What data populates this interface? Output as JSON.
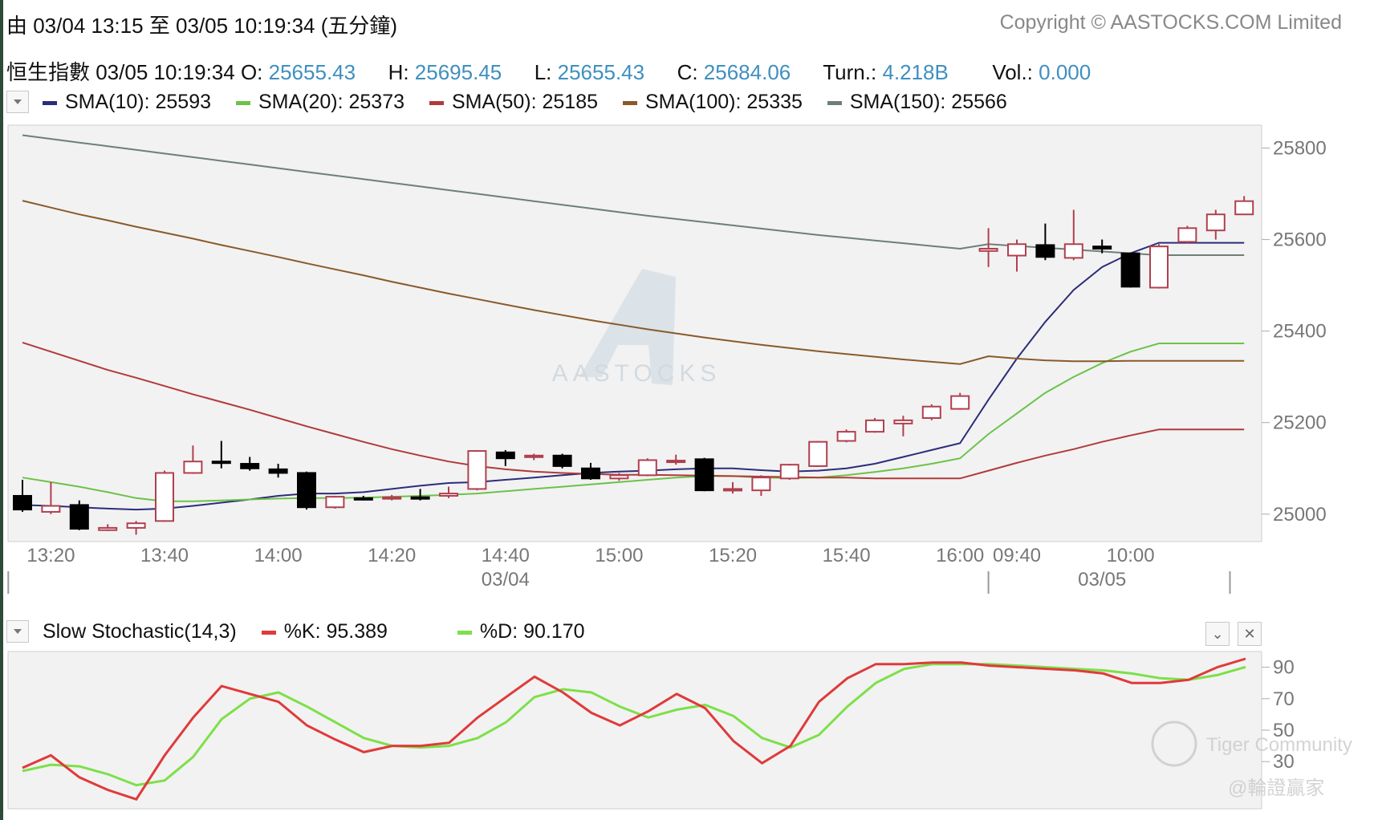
{
  "header": {
    "range_text": "由  03/04 13:15 至  03/05 10:19:34 (五分鐘)",
    "copyright": "Copyright © AASTOCKS.COM Limited"
  },
  "quote": {
    "name_time": "恒生指數  03/05 10:19:34",
    "o_label": "O:",
    "o_value": "25655.43",
    "h_label": "H:",
    "h_value": "25695.45",
    "l_label": "L:",
    "l_value": "25655.43",
    "c_label": "C:",
    "c_value": "25684.06",
    "turn_label": "Turn.:",
    "turn_value": "4.218B",
    "vol_label": "Vol.:",
    "vol_value": "0.000"
  },
  "sma_legend": [
    {
      "label": "SMA(10): 25593",
      "color": "#2b2d7a"
    },
    {
      "label": "SMA(20): 25373",
      "color": "#6cc24a"
    },
    {
      "label": "SMA(50): 25185",
      "color": "#b23a3a"
    },
    {
      "label": "SMA(100): 25335",
      "color": "#8a5a2a"
    },
    {
      "label": "SMA(150): 25566",
      "color": "#6e7f7a"
    }
  ],
  "stoch_legend": {
    "title": "Slow Stochastic(14,3)",
    "k_label": "%K: 95.389",
    "k_color": "#e03a3a",
    "d_label": "%D: 90.170",
    "d_color": "#7de04a"
  },
  "watermarks": {
    "aastocks": "AASTOCKS",
    "tiger": "Tiger Community",
    "tiger_sub": "@輪證贏家"
  },
  "chart_data": {
    "type": "candlestick",
    "price_axis": {
      "ticks": [
        25000,
        25200,
        25400,
        25600,
        25800
      ],
      "range": [
        24940,
        25850
      ]
    },
    "time_axis": {
      "tick_labels": [
        {
          "label": "13:20",
          "index": 1
        },
        {
          "label": "13:40",
          "index": 5
        },
        {
          "label": "14:00",
          "index": 9
        },
        {
          "label": "14:20",
          "index": 13
        },
        {
          "label": "14:40",
          "index": 17
        },
        {
          "label": "15:00",
          "index": 21
        },
        {
          "label": "15:20",
          "index": 25
        },
        {
          "label": "15:40",
          "index": 29
        },
        {
          "label": "16:00",
          "index": 33
        },
        {
          "label": "09:40",
          "index": 35
        },
        {
          "label": "10:00",
          "index": 39
        }
      ],
      "date_labels": [
        {
          "label": "03/04",
          "index": 17
        },
        {
          "label": "03/05",
          "index": 38
        }
      ],
      "day_separators": [
        -0.5,
        34,
        42.5
      ]
    },
    "candles": [
      {
        "o": 25040,
        "h": 25075,
        "l": 25005,
        "c": 25010
      },
      {
        "o": 25005,
        "h": 25070,
        "l": 25000,
        "c": 25018
      },
      {
        "o": 25020,
        "h": 25030,
        "l": 24965,
        "c": 24968
      },
      {
        "o": 24965,
        "h": 24978,
        "l": 24963,
        "c": 24970
      },
      {
        "o": 24970,
        "h": 24985,
        "l": 24955,
        "c": 24980
      },
      {
        "o": 24985,
        "h": 25095,
        "l": 24983,
        "c": 25090
      },
      {
        "o": 25090,
        "h": 25150,
        "l": 25088,
        "c": 25115
      },
      {
        "o": 25115,
        "h": 25160,
        "l": 25100,
        "c": 25112
      },
      {
        "o": 25110,
        "h": 25125,
        "l": 25095,
        "c": 25100
      },
      {
        "o": 25098,
        "h": 25110,
        "l": 25080,
        "c": 25090
      },
      {
        "o": 25090,
        "h": 25093,
        "l": 25010,
        "c": 25015
      },
      {
        "o": 25015,
        "h": 25040,
        "l": 25012,
        "c": 25038
      },
      {
        "o": 25035,
        "h": 25040,
        "l": 25030,
        "c": 25034
      },
      {
        "o": 25035,
        "h": 25042,
        "l": 25030,
        "c": 25037
      },
      {
        "o": 25037,
        "h": 25055,
        "l": 25030,
        "c": 25036
      },
      {
        "o": 25040,
        "h": 25060,
        "l": 25035,
        "c": 25045
      },
      {
        "o": 25055,
        "h": 25140,
        "l": 25052,
        "c": 25138
      },
      {
        "o": 25135,
        "h": 25140,
        "l": 25105,
        "c": 25122
      },
      {
        "o": 25125,
        "h": 25132,
        "l": 25118,
        "c": 25128
      },
      {
        "o": 25128,
        "h": 25132,
        "l": 25100,
        "c": 25105
      },
      {
        "o": 25100,
        "h": 25112,
        "l": 25075,
        "c": 25078
      },
      {
        "o": 25078,
        "h": 25090,
        "l": 25073,
        "c": 25085
      },
      {
        "o": 25085,
        "h": 25122,
        "l": 25083,
        "c": 25118
      },
      {
        "o": 25115,
        "h": 25130,
        "l": 25108,
        "c": 25117
      },
      {
        "o": 25120,
        "h": 25123,
        "l": 25050,
        "c": 25052
      },
      {
        "o": 25053,
        "h": 25070,
        "l": 25045,
        "c": 25055
      },
      {
        "o": 25052,
        "h": 25085,
        "l": 25040,
        "c": 25080
      },
      {
        "o": 25078,
        "h": 25110,
        "l": 25075,
        "c": 25108
      },
      {
        "o": 25105,
        "h": 25160,
        "l": 25103,
        "c": 25158
      },
      {
        "o": 25160,
        "h": 25185,
        "l": 25157,
        "c": 25180
      },
      {
        "o": 25180,
        "h": 25210,
        "l": 25178,
        "c": 25205
      },
      {
        "o": 25198,
        "h": 25215,
        "l": 25170,
        "c": 25205
      },
      {
        "o": 25210,
        "h": 25240,
        "l": 25205,
        "c": 25235
      },
      {
        "o": 25230,
        "h": 25265,
        "l": 25228,
        "c": 25258
      },
      {
        "o": 25575,
        "h": 25625,
        "l": 25540,
        "c": 25580
      },
      {
        "o": 25565,
        "h": 25600,
        "l": 25530,
        "c": 25590
      },
      {
        "o": 25588,
        "h": 25635,
        "l": 25555,
        "c": 25562
      },
      {
        "o": 25560,
        "h": 25665,
        "l": 25555,
        "c": 25590
      },
      {
        "o": 25585,
        "h": 25600,
        "l": 25570,
        "c": 25580
      },
      {
        "o": 25570,
        "h": 25572,
        "l": 25495,
        "c": 25497
      },
      {
        "o": 25495,
        "h": 25590,
        "l": 25493,
        "c": 25585
      },
      {
        "o": 25595,
        "h": 25630,
        "l": 25592,
        "c": 25625
      },
      {
        "o": 25620,
        "h": 25665,
        "l": 25600,
        "c": 25655
      },
      {
        "o": 25655,
        "h": 25695,
        "l": 25655,
        "c": 25684
      }
    ],
    "sma": {
      "SMA(10)": [
        25020,
        25018,
        25015,
        25012,
        25010,
        25012,
        25018,
        25025,
        25032,
        25040,
        25045,
        25045,
        25048,
        25055,
        25062,
        25068,
        25070,
        25075,
        25080,
        25085,
        25090,
        25093,
        25095,
        25098,
        25100,
        25100,
        25096,
        25093,
        25095,
        25100,
        25110,
        25125,
        25140,
        25155,
        25250,
        25340,
        25420,
        25490,
        25540,
        25570,
        25593,
        25593,
        25593,
        25593
      ],
      "SMA(20)": [
        25080,
        25070,
        25060,
        25048,
        25035,
        25028,
        25028,
        25030,
        25032,
        25034,
        25035,
        25035,
        25036,
        25038,
        25040,
        25042,
        25045,
        25050,
        25055,
        25060,
        25065,
        25070,
        25075,
        25080,
        25083,
        25083,
        25080,
        25079,
        25080,
        25085,
        25092,
        25100,
        25110,
        25122,
        25175,
        25220,
        25265,
        25300,
        25330,
        25355,
        25373,
        25373,
        25373,
        25373
      ],
      "SMA(50)": [
        25375,
        25355,
        25335,
        25315,
        25298,
        25280,
        25262,
        25245,
        25228,
        25210,
        25192,
        25175,
        25158,
        25142,
        25128,
        25115,
        25105,
        25098,
        25093,
        25090,
        25088,
        25086,
        25086,
        25085,
        25084,
        25083,
        25082,
        25081,
        25080,
        25080,
        25078,
        25078,
        25078,
        25078,
        25095,
        25112,
        25128,
        25142,
        25158,
        25172,
        25185,
        25185,
        25185,
        25185
      ],
      "SMA(100)": [
        25685,
        25670,
        25655,
        25642,
        25628,
        25615,
        25602,
        25588,
        25575,
        25562,
        25548,
        25535,
        25522,
        25508,
        25495,
        25482,
        25470,
        25458,
        25446,
        25435,
        25424,
        25414,
        25404,
        25395,
        25386,
        25378,
        25370,
        25363,
        25356,
        25350,
        25344,
        25338,
        25333,
        25328,
        25345,
        25340,
        25336,
        25334,
        25334,
        25335,
        25335,
        25335,
        25335,
        25335
      ],
      "SMA(150)": [
        25828,
        25820,
        25812,
        25804,
        25796,
        25788,
        25780,
        25772,
        25764,
        25756,
        25748,
        25740,
        25732,
        25724,
        25716,
        25708,
        25700,
        25692,
        25684,
        25676,
        25668,
        25660,
        25652,
        25645,
        25638,
        25631,
        25624,
        25617,
        25610,
        25604,
        25598,
        25592,
        25586,
        25580,
        25590,
        25586,
        25582,
        25578,
        25574,
        25570,
        25566,
        25566,
        25566,
        25566
      ]
    },
    "stochastic": {
      "axis_ticks": [
        30,
        50,
        70,
        90
      ],
      "range": [
        0,
        100
      ],
      "K": [
        26,
        34,
        20,
        12,
        6,
        34,
        58,
        78,
        73,
        68,
        53,
        44,
        36,
        40,
        40,
        42,
        58,
        71,
        84,
        74,
        61,
        53,
        62,
        73,
        64,
        43,
        29,
        40,
        68,
        83,
        92,
        92,
        93,
        93,
        91,
        90,
        89,
        88,
        86,
        80,
        80,
        82,
        90,
        95.389
      ],
      "D": [
        24,
        28,
        27,
        22,
        15,
        18,
        33,
        57,
        70,
        74,
        65,
        55,
        45,
        40,
        39,
        40,
        45,
        55,
        71,
        76,
        74,
        65,
        58,
        63,
        66,
        59,
        45,
        39,
        47,
        65,
        80,
        89,
        92,
        92,
        92,
        91,
        90,
        89,
        88,
        86,
        83,
        82,
        85,
        90.17
      ]
    }
  }
}
